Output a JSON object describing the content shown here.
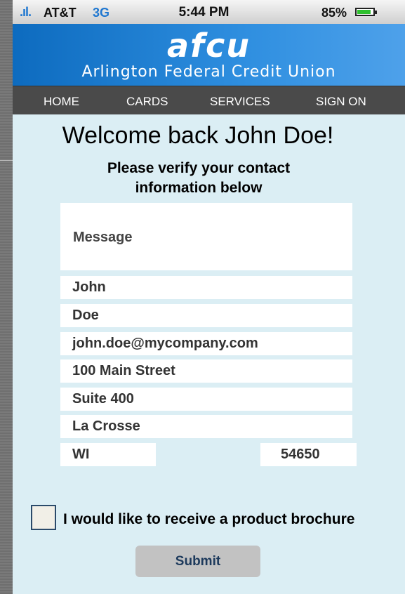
{
  "status_bar": {
    "signal": ".ıl.",
    "carrier": "AT&T",
    "network": "3G",
    "time": "5:44 PM",
    "battery_percent": "85%",
    "battery_level": 0.85
  },
  "header": {
    "logo": "afcu",
    "tagline": "Arlington Federal Credit Union"
  },
  "nav": {
    "items": [
      "HOME",
      "CARDS",
      "SERVICES",
      "SIGN ON"
    ]
  },
  "main": {
    "welcome": "Welcome back John Doe!",
    "subtitle_line1": "Please verify your contact",
    "subtitle_line2": "information below"
  },
  "form": {
    "message_label": "Message",
    "first_name": "John",
    "last_name": "Doe",
    "email": "john.doe@mycompany.com",
    "address1": "100 Main Street",
    "address2": "Suite 400",
    "city": "La Crosse",
    "state": "WI",
    "zip": "54650",
    "brochure_label": "I would like to receive a product brochure",
    "brochure_checked": false,
    "submit_label": "Submit"
  },
  "colors": {
    "header_blue": "#1f7fd6",
    "nav_bg": "#4a4a4a",
    "page_bg": "#dbeef4"
  }
}
